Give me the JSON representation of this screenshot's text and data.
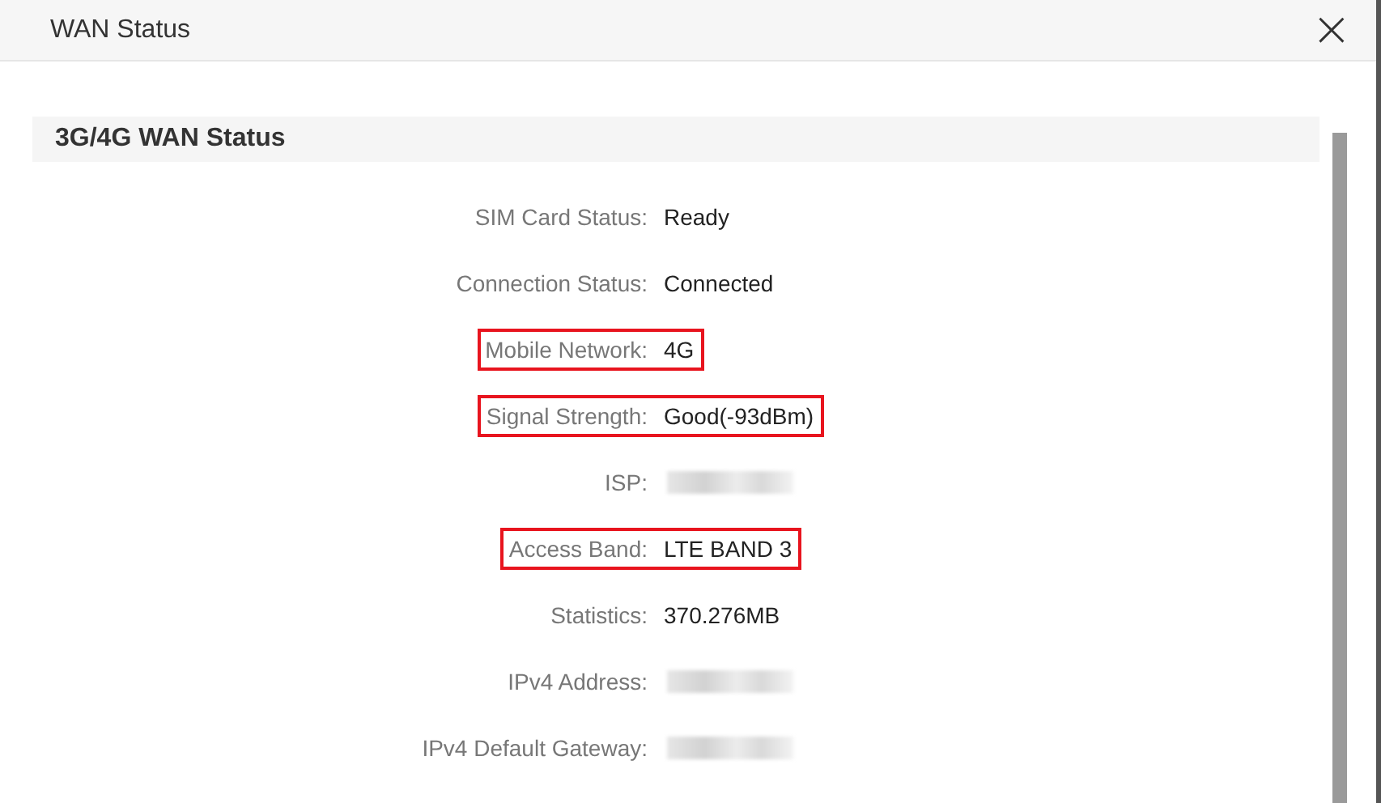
{
  "dialog": {
    "title": "WAN Status",
    "close_label": "×"
  },
  "section": {
    "title": "3G/4G WAN Status"
  },
  "rows": [
    {
      "label": "SIM Card Status:",
      "kind": "text",
      "value": "Ready",
      "highlighted": false
    },
    {
      "label": "Connection Status:",
      "kind": "text",
      "value": "Connected",
      "highlighted": false
    },
    {
      "label": "Mobile Network:",
      "kind": "text",
      "value": "4G",
      "highlighted": true
    },
    {
      "label": "Signal Strength:",
      "kind": "text",
      "value": "Good(-93dBm)",
      "highlighted": true
    },
    {
      "label": "ISP:",
      "kind": "redacted",
      "highlighted": false
    },
    {
      "label": "Access Band:",
      "kind": "text",
      "value": "LTE BAND 3",
      "highlighted": true
    },
    {
      "label": "Statistics:",
      "kind": "text",
      "value": "370.276MB",
      "highlighted": false
    },
    {
      "label": "IPv4 Address:",
      "kind": "redacted",
      "highlighted": false
    },
    {
      "label": "IPv4 Default Gateway:",
      "kind": "redacted",
      "highlighted": false
    }
  ]
}
